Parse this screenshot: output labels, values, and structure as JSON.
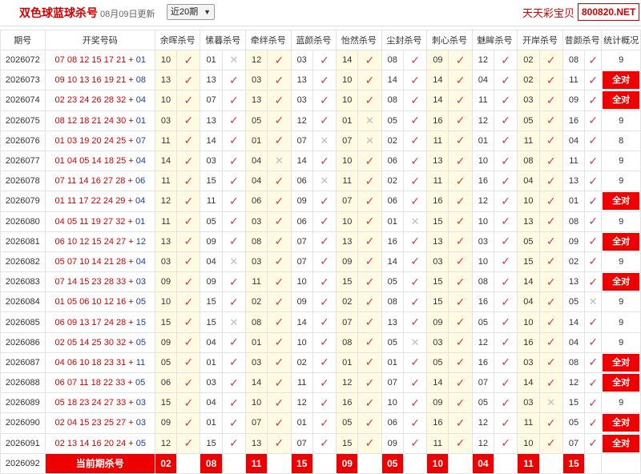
{
  "header": {
    "title": "双色球蓝球杀号",
    "date": "08月09日更新",
    "period_select": "近20期",
    "brand": "天天彩宝贝",
    "site": "800820.NET"
  },
  "columns": [
    "期号",
    "开奖号码",
    "余晖杀号",
    "愫暮杀号",
    "牵绊杀号",
    "蓝颜杀号",
    "怡然杀号",
    "尘封杀号",
    "刺心杀号",
    "魅眸杀号",
    "开岸杀号",
    "昔颜杀号",
    "统计概况"
  ],
  "all_right_label": "全对",
  "rows": [
    {
      "p": "2026072",
      "red": "07 08 12 15 17 21",
      "blue": "01",
      "k": [
        [
          "10",
          1
        ],
        [
          "01",
          0
        ],
        [
          "12",
          1
        ],
        [
          "03",
          1
        ],
        [
          "14",
          1
        ],
        [
          "08",
          1
        ],
        [
          "09",
          1
        ],
        [
          "12",
          1
        ],
        [
          "02",
          1
        ],
        [
          "08",
          1
        ]
      ],
      "s": "9"
    },
    {
      "p": "2026073",
      "red": "09 10 13 16 19 21",
      "blue": "08",
      "k": [
        [
          "13",
          1
        ],
        [
          "13",
          1
        ],
        [
          "03",
          1
        ],
        [
          "13",
          1
        ],
        [
          "10",
          1
        ],
        [
          "14",
          1
        ],
        [
          "14",
          1
        ],
        [
          "04",
          1
        ],
        [
          "02",
          1
        ],
        [
          "11",
          1
        ]
      ],
      "s": "全对"
    },
    {
      "p": "2026074",
      "red": "02 23 24 26 28 32",
      "blue": "04",
      "k": [
        [
          "10",
          1
        ],
        [
          "07",
          1
        ],
        [
          "13",
          1
        ],
        [
          "03",
          1
        ],
        [
          "10",
          1
        ],
        [
          "08",
          1
        ],
        [
          "14",
          1
        ],
        [
          "11",
          1
        ],
        [
          "03",
          1
        ],
        [
          "09",
          1
        ]
      ],
      "s": "全对"
    },
    {
      "p": "2026075",
      "red": "08 12 18 21 24 30",
      "blue": "01",
      "k": [
        [
          "03",
          1
        ],
        [
          "13",
          1
        ],
        [
          "05",
          1
        ],
        [
          "12",
          1
        ],
        [
          "01",
          0
        ],
        [
          "05",
          1
        ],
        [
          "16",
          1
        ],
        [
          "12",
          1
        ],
        [
          "05",
          1
        ],
        [
          "16",
          1
        ]
      ],
      "s": "9"
    },
    {
      "p": "2026076",
      "red": "01 03 19 20 24 25",
      "blue": "07",
      "k": [
        [
          "11",
          1
        ],
        [
          "14",
          1
        ],
        [
          "01",
          1
        ],
        [
          "07",
          0
        ],
        [
          "07",
          0
        ],
        [
          "02",
          1
        ],
        [
          "11",
          1
        ],
        [
          "01",
          1
        ],
        [
          "11",
          1
        ],
        [
          "04",
          1
        ]
      ],
      "s": "8"
    },
    {
      "p": "2026077",
      "red": "01 04 05 14 18 25",
      "blue": "04",
      "k": [
        [
          "14",
          1
        ],
        [
          "03",
          1
        ],
        [
          "04",
          0
        ],
        [
          "14",
          1
        ],
        [
          "10",
          1
        ],
        [
          "06",
          1
        ],
        [
          "13",
          1
        ],
        [
          "10",
          1
        ],
        [
          "08",
          1
        ],
        [
          "11",
          1
        ]
      ],
      "s": "9"
    },
    {
      "p": "2026078",
      "red": "07 11 14 16 27 28",
      "blue": "06",
      "k": [
        [
          "11",
          1
        ],
        [
          "15",
          1
        ],
        [
          "04",
          1
        ],
        [
          "06",
          0
        ],
        [
          "11",
          1
        ],
        [
          "02",
          1
        ],
        [
          "11",
          1
        ],
        [
          "16",
          1
        ],
        [
          "04",
          1
        ],
        [
          "13",
          1
        ]
      ],
      "s": "9"
    },
    {
      "p": "2026079",
      "red": "01 11 17 22 24 29",
      "blue": "04",
      "k": [
        [
          "12",
          1
        ],
        [
          "11",
          1
        ],
        [
          "06",
          1
        ],
        [
          "09",
          1
        ],
        [
          "07",
          1
        ],
        [
          "06",
          1
        ],
        [
          "16",
          1
        ],
        [
          "12",
          1
        ],
        [
          "10",
          1
        ],
        [
          "01",
          1
        ]
      ],
      "s": "全对"
    },
    {
      "p": "2026080",
      "red": "04 05 11 19 27 32",
      "blue": "01",
      "k": [
        [
          "11",
          1
        ],
        [
          "05",
          1
        ],
        [
          "03",
          1
        ],
        [
          "06",
          1
        ],
        [
          "10",
          1
        ],
        [
          "01",
          0
        ],
        [
          "15",
          1
        ],
        [
          "10",
          1
        ],
        [
          "13",
          1
        ],
        [
          "08",
          1
        ]
      ],
      "s": "9"
    },
    {
      "p": "2026081",
      "red": "06 10 12 15 24 27",
      "blue": "12",
      "k": [
        [
          "13",
          1
        ],
        [
          "09",
          1
        ],
        [
          "08",
          1
        ],
        [
          "07",
          1
        ],
        [
          "13",
          1
        ],
        [
          "16",
          1
        ],
        [
          "13",
          1
        ],
        [
          "03",
          1
        ],
        [
          "05",
          1
        ],
        [
          "09",
          1
        ]
      ],
      "s": "全对"
    },
    {
      "p": "2026082",
      "red": "05 07 10 14 21 28",
      "blue": "04",
      "k": [
        [
          "03",
          1
        ],
        [
          "04",
          0
        ],
        [
          "03",
          1
        ],
        [
          "07",
          1
        ],
        [
          "09",
          1
        ],
        [
          "14",
          1
        ],
        [
          "03",
          1
        ],
        [
          "10",
          1
        ],
        [
          "15",
          1
        ],
        [
          "02",
          1
        ]
      ],
      "s": "9"
    },
    {
      "p": "2026083",
      "red": "07 14 15 23 28 33",
      "blue": "03",
      "k": [
        [
          "09",
          1
        ],
        [
          "09",
          1
        ],
        [
          "11",
          1
        ],
        [
          "10",
          1
        ],
        [
          "15",
          1
        ],
        [
          "05",
          1
        ],
        [
          "15",
          1
        ],
        [
          "08",
          1
        ],
        [
          "14",
          1
        ],
        [
          "13",
          1
        ]
      ],
      "s": "全对"
    },
    {
      "p": "2026084",
      "red": "01 05 06 10 12 16",
      "blue": "05",
      "k": [
        [
          "10",
          1
        ],
        [
          "15",
          1
        ],
        [
          "02",
          1
        ],
        [
          "09",
          1
        ],
        [
          "02",
          1
        ],
        [
          "08",
          1
        ],
        [
          "15",
          1
        ],
        [
          "16",
          1
        ],
        [
          "04",
          1
        ],
        [
          "05",
          0
        ]
      ],
      "s": "9"
    },
    {
      "p": "2026085",
      "red": "06 09 13 17 24 28",
      "blue": "15",
      "k": [
        [
          "15",
          1
        ],
        [
          "15",
          0
        ],
        [
          "08",
          1
        ],
        [
          "14",
          1
        ],
        [
          "07",
          1
        ],
        [
          "13",
          1
        ],
        [
          "09",
          1
        ],
        [
          "05",
          1
        ],
        [
          "10",
          1
        ],
        [
          "14",
          1
        ]
      ],
      "s": "9"
    },
    {
      "p": "2026086",
      "red": "02 05 14 25 30 32",
      "blue": "05",
      "k": [
        [
          "09",
          1
        ],
        [
          "04",
          1
        ],
        [
          "01",
          1
        ],
        [
          "10",
          1
        ],
        [
          "08",
          1
        ],
        [
          "05",
          0
        ],
        [
          "03",
          1
        ],
        [
          "12",
          1
        ],
        [
          "16",
          1
        ],
        [
          "04",
          1
        ]
      ],
      "s": "9"
    },
    {
      "p": "2026087",
      "red": "04 06 10 18 23 31",
      "blue": "11",
      "k": [
        [
          "05",
          1
        ],
        [
          "01",
          1
        ],
        [
          "03",
          1
        ],
        [
          "02",
          1
        ],
        [
          "01",
          1
        ],
        [
          "01",
          1
        ],
        [
          "05",
          1
        ],
        [
          "16",
          1
        ],
        [
          "03",
          1
        ],
        [
          "08",
          1
        ]
      ],
      "s": "全对"
    },
    {
      "p": "2026088",
      "red": "06 07 11 18 22 33",
      "blue": "05",
      "k": [
        [
          "06",
          1
        ],
        [
          "03",
          1
        ],
        [
          "14",
          1
        ],
        [
          "11",
          1
        ],
        [
          "12",
          1
        ],
        [
          "07",
          1
        ],
        [
          "14",
          1
        ],
        [
          "07",
          1
        ],
        [
          "14",
          1
        ],
        [
          "12",
          1
        ]
      ],
      "s": "全对"
    },
    {
      "p": "2026089",
      "red": "05 18 23 24 27 33",
      "blue": "03",
      "k": [
        [
          "15",
          1
        ],
        [
          "04",
          1
        ],
        [
          "10",
          1
        ],
        [
          "12",
          1
        ],
        [
          "16",
          1
        ],
        [
          "10",
          1
        ],
        [
          "09",
          1
        ],
        [
          "05",
          1
        ],
        [
          "03",
          0
        ],
        [
          "15",
          1
        ]
      ],
      "s": "9"
    },
    {
      "p": "2026090",
      "red": "02 04 15 23 25 27",
      "blue": "03",
      "k": [
        [
          "09",
          1
        ],
        [
          "01",
          1
        ],
        [
          "07",
          1
        ],
        [
          "01",
          1
        ],
        [
          "05",
          1
        ],
        [
          "06",
          1
        ],
        [
          "16",
          1
        ],
        [
          "12",
          1
        ],
        [
          "11",
          1
        ],
        [
          "05",
          1
        ]
      ],
      "s": "全对"
    },
    {
      "p": "2026091",
      "red": "02 13 14 16 20 24",
      "blue": "05",
      "k": [
        [
          "12",
          1
        ],
        [
          "15",
          1
        ],
        [
          "13",
          1
        ],
        [
          "07",
          1
        ],
        [
          "15",
          1
        ],
        [
          "09",
          1
        ],
        [
          "11",
          1
        ],
        [
          "12",
          1
        ],
        [
          "10",
          1
        ],
        [
          "07",
          1
        ]
      ],
      "s": "全对"
    }
  ],
  "current": {
    "period": "2026092",
    "label": "当前期杀号",
    "values": [
      "02",
      "08",
      "11",
      "15",
      "09",
      "05",
      "10",
      "04",
      "11",
      "15"
    ]
  },
  "colors": {
    "accent": "#ee0000",
    "check": "#d43a4a",
    "blue_ball": "#1a3ca8",
    "highlight": "#fffbe3"
  }
}
